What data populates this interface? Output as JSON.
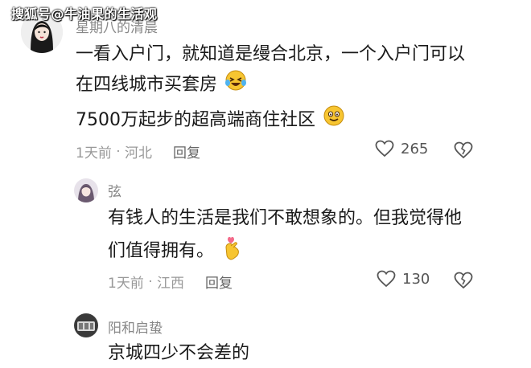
{
  "watermark": "搜狐号@牛油果的生活观",
  "comments": [
    {
      "username": "星期八的清晨",
      "lines": [
        "一看入户门，就知道是缦合北京，一个入户门可以",
        "在四线城市买套房",
        "7500万起步的超高端商住社区"
      ],
      "emojis": [
        "laughing-tears-emoji",
        "smiling-emoji"
      ],
      "time": "1天前",
      "location": "河北",
      "reply_label": "回复",
      "like_count": "265"
    },
    {
      "username": "弦",
      "lines": [
        "有钱人的生活是我们不敢想象的。但我觉得他",
        "们值得拥有。"
      ],
      "emojis": [
        "finger-heart-emoji"
      ],
      "time": "1天前",
      "location": "江西",
      "reply_label": "回复",
      "like_count": "130"
    },
    {
      "username": "阳和启蛰",
      "lines": [
        "京城四少不会差的"
      ]
    }
  ],
  "colors": {
    "like_outline": "#555555",
    "emoji_yellow": "#f7c531"
  }
}
